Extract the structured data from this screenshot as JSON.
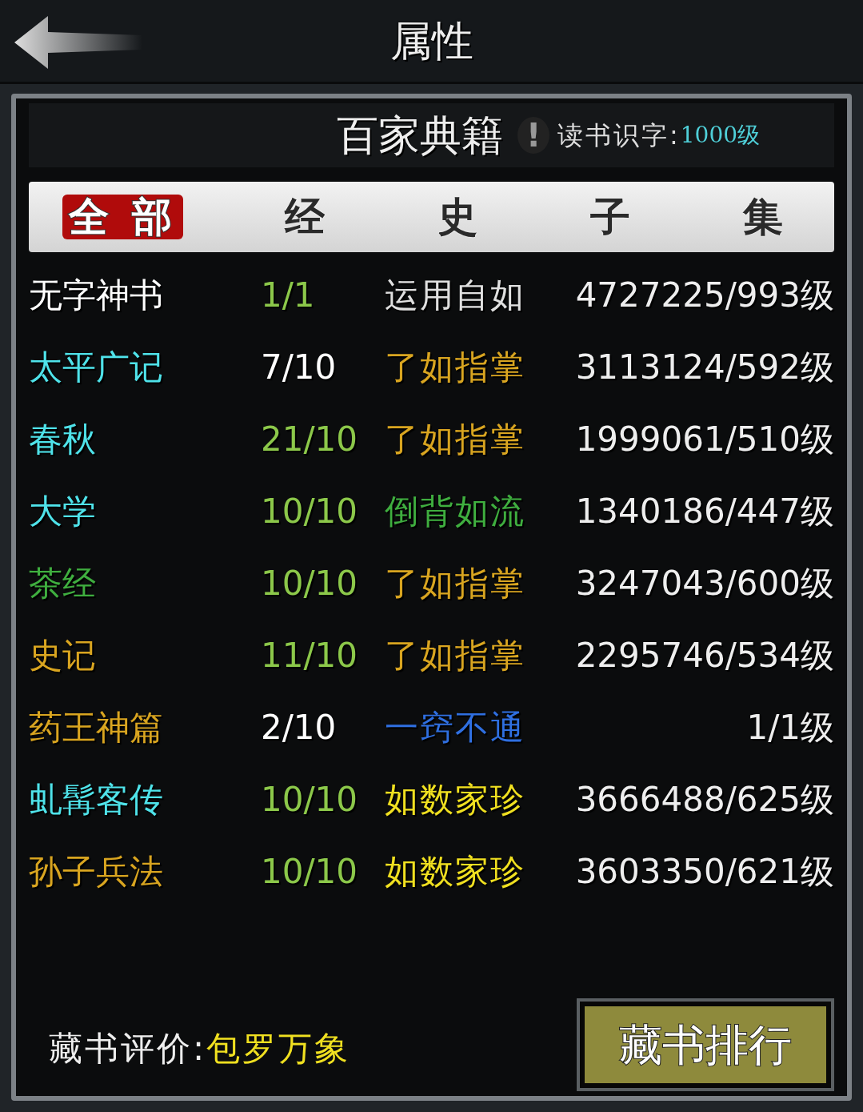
{
  "window": {
    "title": "属性"
  },
  "header": {
    "title": "百家典籍",
    "alert": "!",
    "reading_label": "读书识字:",
    "reading_level": "1000级"
  },
  "tabs": [
    {
      "label": "全 部",
      "selected": true
    },
    {
      "label": "经",
      "selected": false
    },
    {
      "label": "史",
      "selected": false
    },
    {
      "label": "子",
      "selected": false
    },
    {
      "label": "集",
      "selected": false
    }
  ],
  "books": [
    {
      "name": {
        "text": "无字神书",
        "color": "#ffffff"
      },
      "count": {
        "text": "1/1",
        "color": "#8cc84a"
      },
      "grade": {
        "text": "运用自如",
        "color": "#e0e0e0"
      },
      "progress": "4727225/993级"
    },
    {
      "name": {
        "text": "太平广记",
        "color": "#4fe3ea"
      },
      "count": {
        "text": "7/10",
        "color": "#ffffff"
      },
      "grade": {
        "text": "了如指掌",
        "color": "#d9a520"
      },
      "progress": "3113124/592级"
    },
    {
      "name": {
        "text": "春秋",
        "color": "#4fe3ea"
      },
      "count": {
        "text": "21/10",
        "color": "#8cc84a"
      },
      "grade": {
        "text": "了如指掌",
        "color": "#d9a520"
      },
      "progress": "1999061/510级"
    },
    {
      "name": {
        "text": "大学",
        "color": "#4fe3ea"
      },
      "count": {
        "text": "10/10",
        "color": "#8cc84a"
      },
      "grade": {
        "text": "倒背如流",
        "color": "#3fae3f"
      },
      "progress": "1340186/447级"
    },
    {
      "name": {
        "text": "茶经",
        "color": "#3fae3f"
      },
      "count": {
        "text": "10/10",
        "color": "#8cc84a"
      },
      "grade": {
        "text": "了如指掌",
        "color": "#d9a520"
      },
      "progress": "3247043/600级"
    },
    {
      "name": {
        "text": "史记",
        "color": "#d9a520"
      },
      "count": {
        "text": "11/10",
        "color": "#8cc84a"
      },
      "grade": {
        "text": "了如指掌",
        "color": "#d9a520"
      },
      "progress": "2295746/534级"
    },
    {
      "name": {
        "text": "药王神篇",
        "color": "#d9a520"
      },
      "count": {
        "text": "2/10",
        "color": "#ffffff"
      },
      "grade": {
        "text": "一窍不通",
        "color": "#2f6fe0"
      },
      "progress": "1/1级"
    },
    {
      "name": {
        "text": "虬髯客传",
        "color": "#4fe3ea"
      },
      "count": {
        "text": "10/10",
        "color": "#8cc84a"
      },
      "grade": {
        "text": "如数家珍",
        "color": "#f0e020"
      },
      "progress": "3666488/625级"
    },
    {
      "name": {
        "text": "孙子兵法",
        "color": "#d9a520"
      },
      "count": {
        "text": "10/10",
        "color": "#8cc84a"
      },
      "grade": {
        "text": "如数家珍",
        "color": "#f0e020"
      },
      "progress": "3603350/621级"
    }
  ],
  "footer": {
    "rating_label": "藏书评价:",
    "rating": "包罗万象",
    "button": "藏书排行"
  }
}
